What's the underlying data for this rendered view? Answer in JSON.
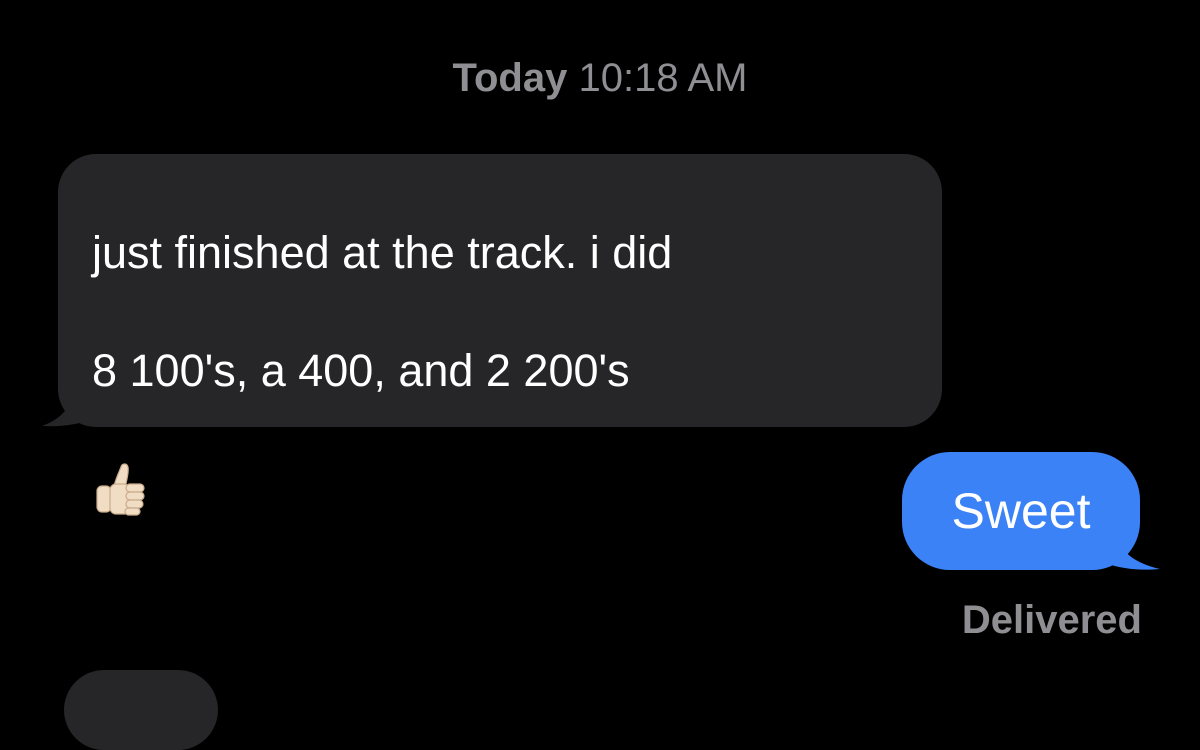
{
  "conversation": {
    "timestamp": {
      "day": "Today",
      "time": "10:18 AM"
    },
    "messages": [
      {
        "direction": "incoming",
        "lines": [
          "just finished at the track. i did",
          "8 100's, a 400, and 2 200's"
        ],
        "emoji": "thumbs-up-icon"
      },
      {
        "direction": "outgoing",
        "text": "Sweet",
        "status": "Delivered"
      }
    ]
  },
  "colors": {
    "background": "#000000",
    "incoming_bubble": "#262628",
    "outgoing_bubble": "#3b82f6",
    "meta_text": "#8e8e93"
  }
}
